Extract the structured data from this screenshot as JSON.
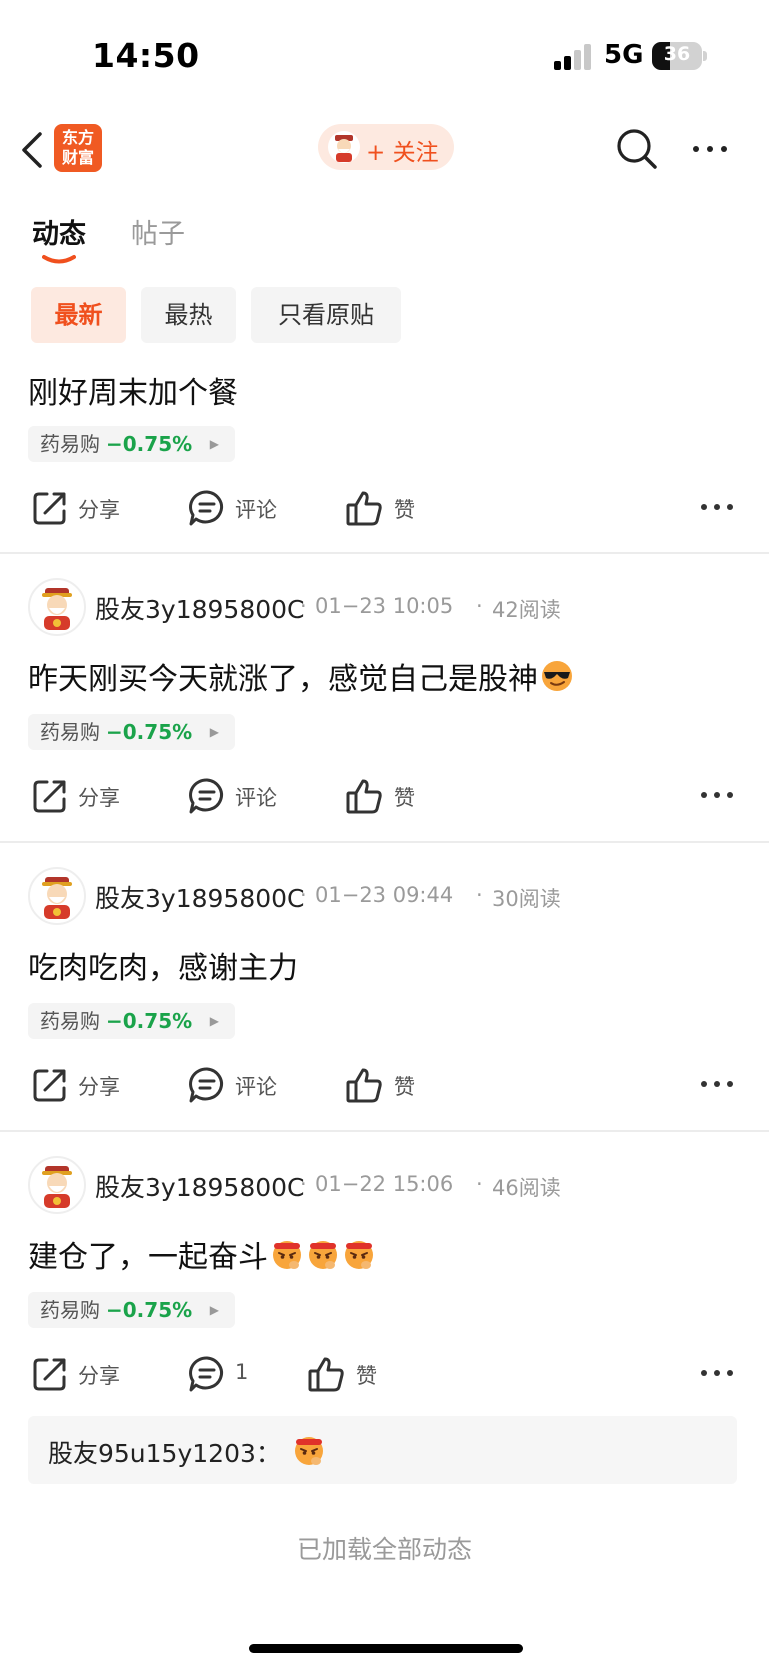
{
  "status": {
    "time": "14:50",
    "network": "5G",
    "battery": "36"
  },
  "nav": {
    "logo_line1": "东方",
    "logo_line2": "财富",
    "follow_label": "+ 关注"
  },
  "tabs": [
    {
      "label": "动态"
    },
    {
      "label": "帖子"
    }
  ],
  "filters": [
    {
      "label": "最新"
    },
    {
      "label": "最热"
    },
    {
      "label": "只看原贴"
    }
  ],
  "feed": {
    "stock_name": "药易购",
    "stock_change": "−0.75%",
    "share_label": "分享",
    "comment_label": "评论",
    "like_label": "赞",
    "accent_color": "#f0501e",
    "down_color": "#1aa34a"
  },
  "posts": [
    {
      "text": "刚好周末加个餐"
    },
    {
      "author": "股友3y1895800C",
      "date": "01−23 10:05",
      "reads": "42阅读",
      "text": "昨天刚买今天就涨了，感觉自己是股神",
      "emoji": [
        "cool-face"
      ]
    },
    {
      "author": "股友3y1895800C",
      "date": "01−23 09:44",
      "reads": "30阅读",
      "text": "吃肉吃肉，感谢主力"
    },
    {
      "author": "股友3y1895800C",
      "date": "01−22 15:06",
      "reads": "46阅读",
      "text": "建仓了，一起奋斗",
      "emoji": [
        "determined-face",
        "determined-face",
        "determined-face"
      ],
      "comment_count": "1"
    }
  ],
  "reply": {
    "user": "股友95u15y1203：",
    "emoji": "determined-face"
  },
  "footer": {
    "end_text": "已加载全部动态"
  }
}
